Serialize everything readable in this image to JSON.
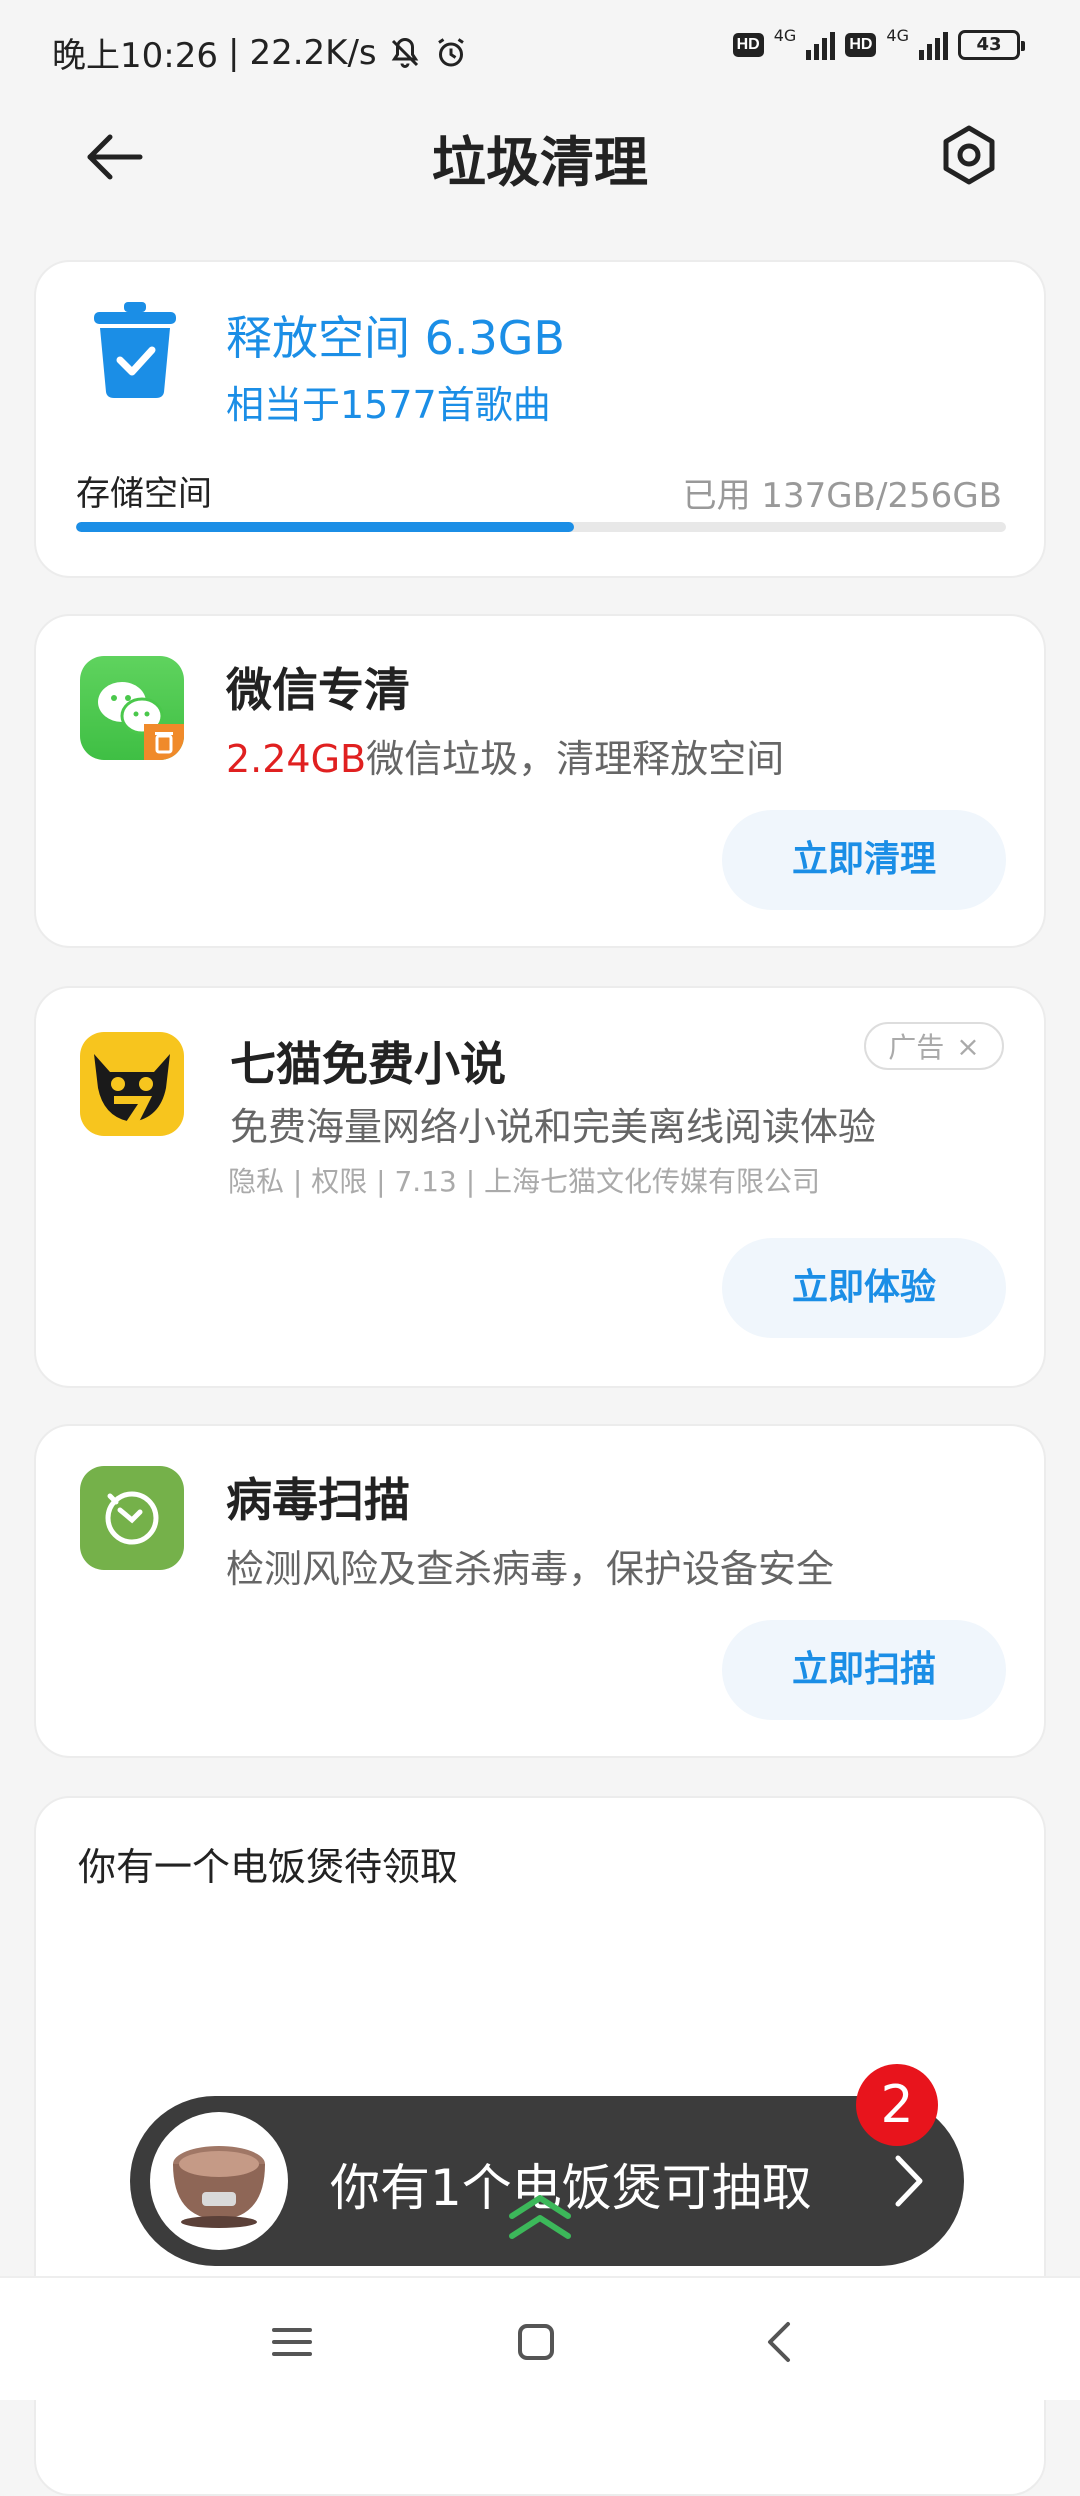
{
  "status_bar": {
    "time": "晚上10:26",
    "speed": "22.2K/s",
    "hd_label": "HD",
    "network_label": "4G",
    "battery": "43"
  },
  "header": {
    "title": "垃圾清理",
    "back_icon": "back-arrow-icon",
    "settings_icon": "settings-icon"
  },
  "storage": {
    "free_title": "释放空间 6.3GB",
    "free_subtitle": "相当于1577首歌曲",
    "label": "存储空间",
    "used_text": "已用 137GB/256GB",
    "used_fraction": 0.535,
    "accent_color": "#1b8ee6"
  },
  "wechat": {
    "title": "微信专清",
    "amount": "2.24GB",
    "amount_color": "#e02020",
    "desc_rest": "微信垃圾，清理释放空间",
    "button": "立即清理"
  },
  "novel": {
    "title": "七猫免费小说",
    "desc": "免费海量网络小说和完美离线阅读体验",
    "meta": "隐私 | 权限 | 7.13 | 上海七猫文化传媒有限公司",
    "ad_label": "广告",
    "ad_close": "×",
    "button": "立即体验"
  },
  "virus": {
    "title": "病毒扫描",
    "desc": "检测风险及查杀病毒，保护设备安全",
    "button": "立即扫描"
  },
  "promo": {
    "title": "你有一个电饭煲待领取"
  },
  "float_banner": {
    "text": "你有1个电饭煲可抽取",
    "badge_count": "2"
  },
  "nav_bar": {
    "menu_icon": "menu-icon",
    "home_icon": "home-icon",
    "back_icon": "back-icon"
  }
}
